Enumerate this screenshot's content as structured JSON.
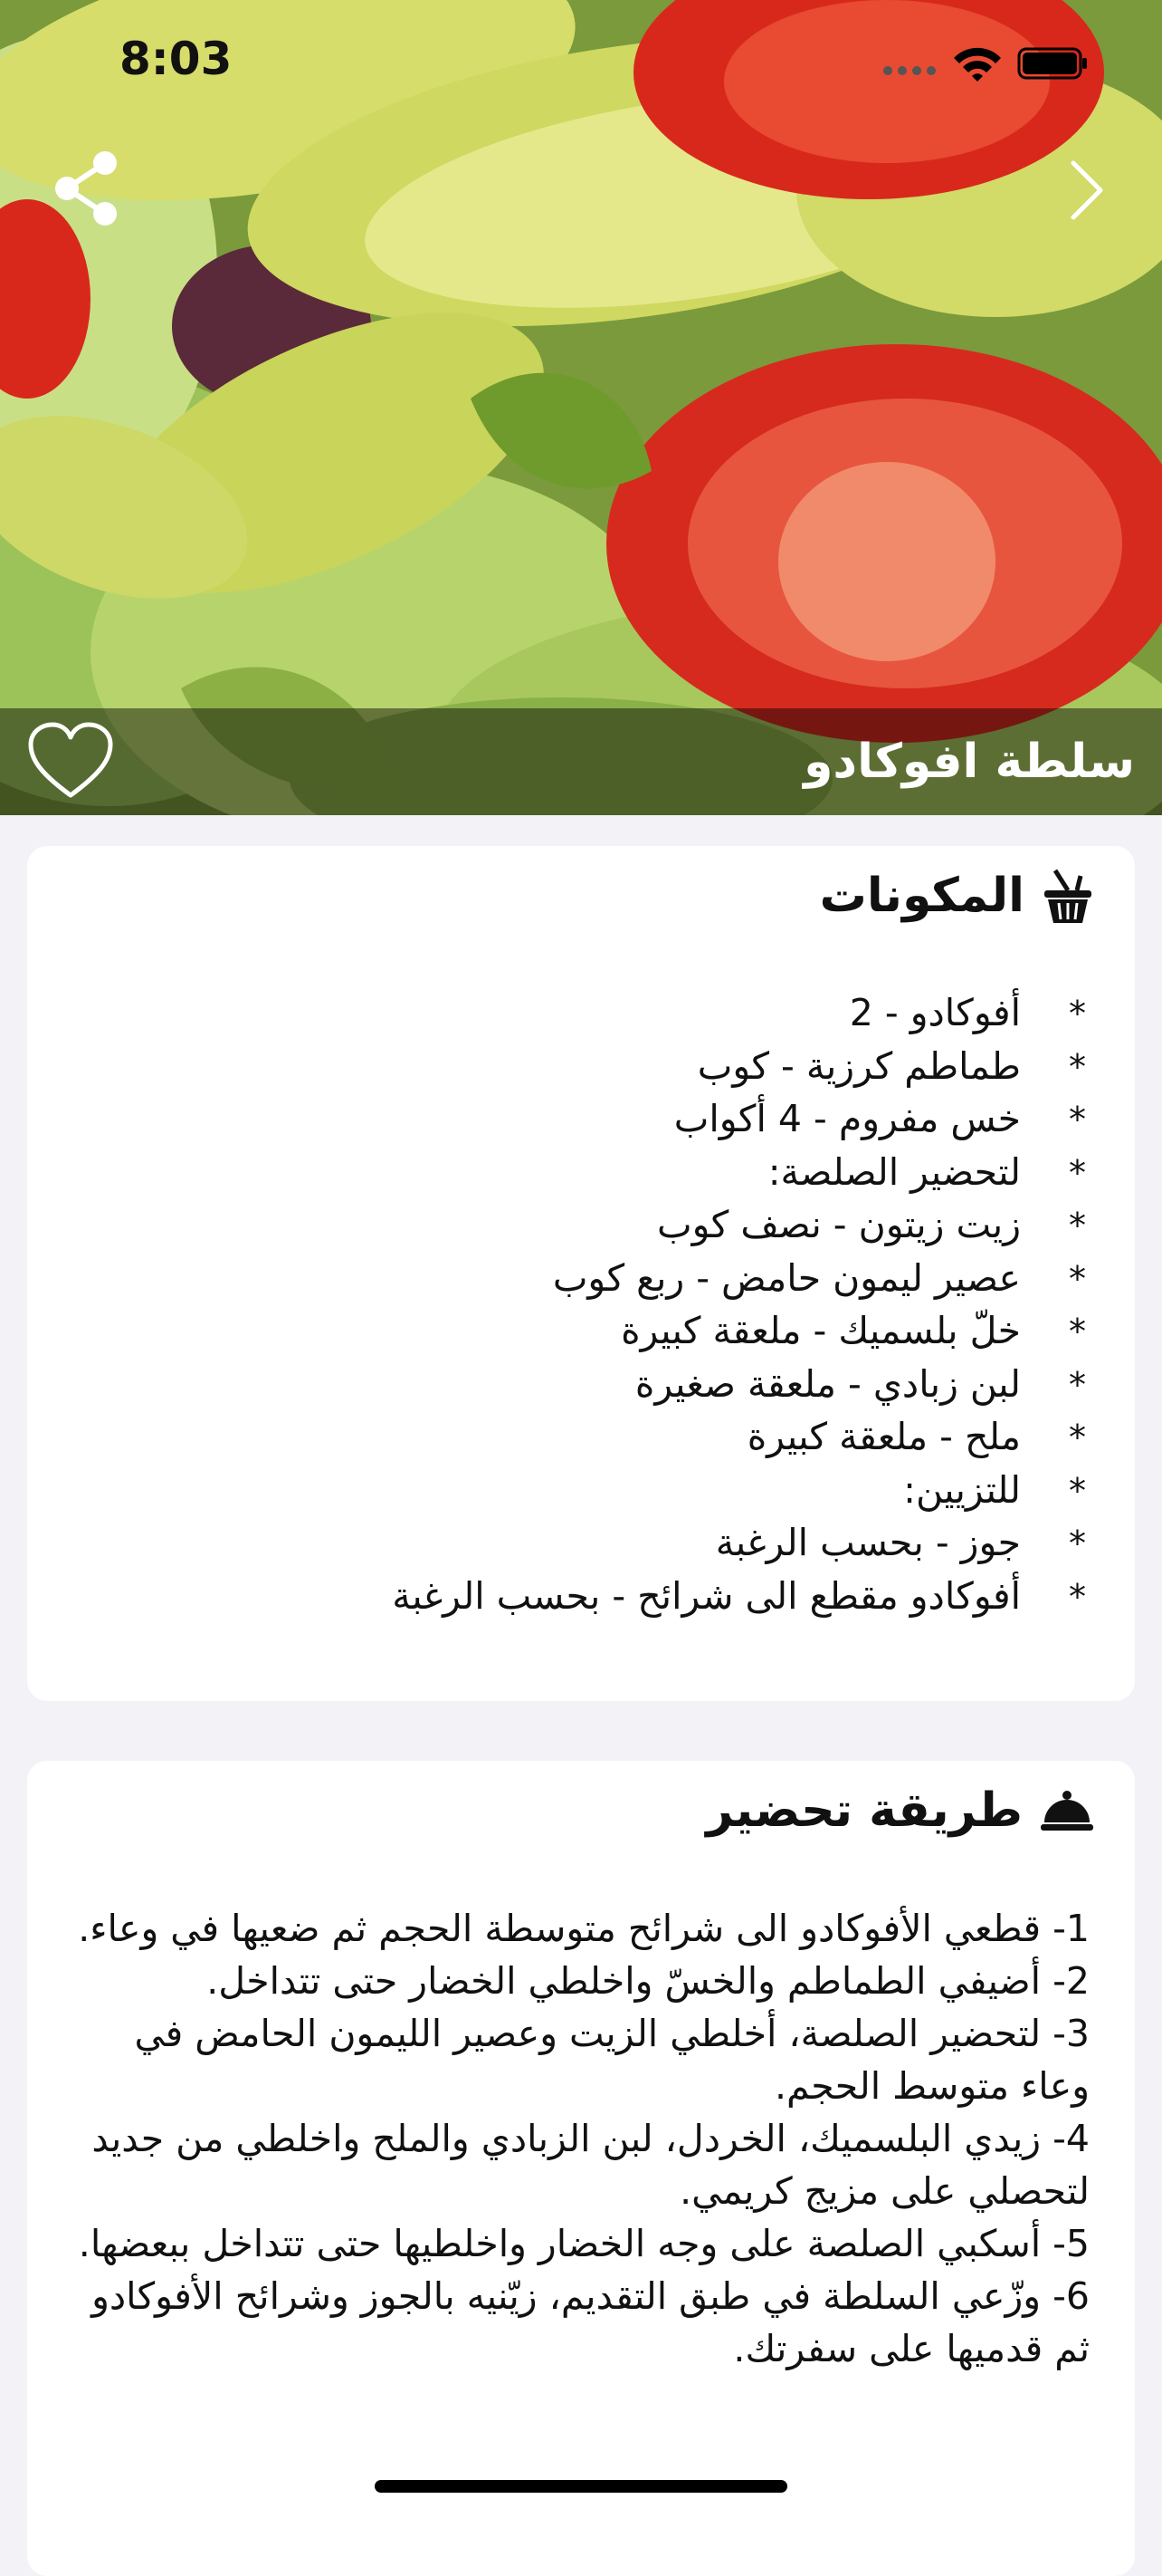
{
  "status": {
    "time": "8:03"
  },
  "colors": {
    "background": "#f2f2f7",
    "card": "#ffffff",
    "text": "#111111"
  },
  "hero": {
    "title": "سلطة افوكادو",
    "icons": [
      "share-icon",
      "chevron-right-icon",
      "heart-outline-icon"
    ]
  },
  "ingredients": {
    "title": "المكونات",
    "icon": "basket-icon",
    "bullet": "*",
    "items": [
      "أفوكادو - 2",
      "طماطم كرزية - كوب",
      "خس مفروم - 4 أكواب",
      "لتحضير الصلصة:",
      "زيت زيتون - نصف كوب",
      "عصير ليمون حامض - ربع كوب",
      "خلّ بلسميك - ملعقة كبيرة",
      "لبن زبادي - ملعقة صغيرة",
      "ملح - ملعقة كبيرة",
      "للتزيين:",
      "جوز - بحسب الرغبة",
      "أفوكادو مقطع الى شرائح - بحسب الرغبة"
    ]
  },
  "preparation": {
    "title": "طريقة تحضير",
    "icon": "cloche-icon",
    "steps": [
      "1- قطعي الأفوكادو الى شرائح متوسطة الحجم ثم ضعيها في وعاء.",
      "2- أضيفي الطماطم والخسّ واخلطي الخضار حتى تتداخل.",
      "3- لتحضير الصلصة، أخلطي الزيت وعصير الليمون الحامض في وعاء متوسط الحجم.",
      "4- زيدي البلسميك، الخردل، لبن الزبادي والملح واخلطي من جديد لتحصلي على مزيج كريمي.",
      "5- أسكبي الصلصة على وجه الخضار واخلطيها حتى تتداخل ببعضها.",
      "6- وزّعي السلطة في طبق التقديم، زيّنيه بالجوز وشرائح الأفوكادو ثم قدميها على سفرتك."
    ]
  }
}
